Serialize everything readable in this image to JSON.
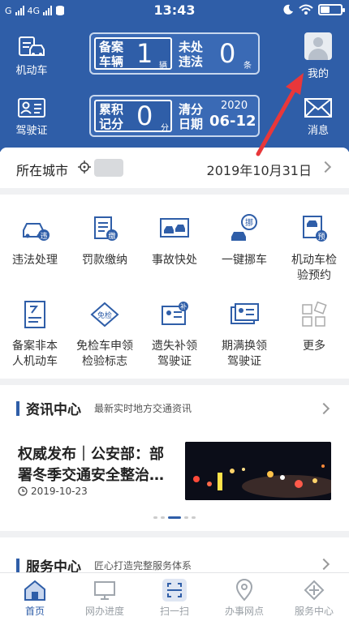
{
  "status_bar": {
    "carrier_left": "G",
    "network": "4G",
    "time": "13:43"
  },
  "header": {
    "left_top": {
      "label": "机动车",
      "icon": "vehicle-icon"
    },
    "left_bottom": {
      "label": "驾驶证",
      "icon": "license-icon"
    },
    "right_top": {
      "label": "我的",
      "icon": "avatar-icon"
    },
    "right_bottom": {
      "label": "消息",
      "icon": "mail-icon"
    },
    "panel_vehicle": {
      "label1": "备案",
      "label2": "车辆",
      "count": "1",
      "unit": "辆",
      "label3": "未处",
      "label4": "违法",
      "violations": "0",
      "unit2": "条"
    },
    "panel_points": {
      "label1": "累积",
      "label2": "记分",
      "points": "0",
      "unit": "分",
      "label3": "清分",
      "label4": "日期",
      "year": "2020",
      "date": "06-12"
    }
  },
  "city_row": {
    "label": "所在城市",
    "date": "2019年10月31日"
  },
  "services_grid": [
    {
      "label": "违法处理",
      "icon": "violation-icon"
    },
    {
      "label": "罚款缴纳",
      "icon": "fine-payment-icon"
    },
    {
      "label": "事故快处",
      "icon": "accident-icon"
    },
    {
      "label": "一键挪车",
      "icon": "move-car-icon"
    },
    {
      "label": "机动车检验预约",
      "icon": "inspection-booking-icon"
    },
    {
      "label": "备案非本人机动车",
      "icon": "register-vehicle-icon"
    },
    {
      "label": "免检车申领检验标志",
      "icon": "exempt-inspection-icon"
    },
    {
      "label": "遗失补领驾驶证",
      "icon": "lost-license-icon"
    },
    {
      "label": "期满换领驾驶证",
      "icon": "renew-license-icon"
    },
    {
      "label": "更多",
      "icon": "more-icon"
    }
  ],
  "news": {
    "title": "资讯中心",
    "subtitle": "最新实时地方交通资讯",
    "headline": "权威发布｜公安部：部署冬季交通安全整治…",
    "date": "2019-10-23"
  },
  "service_center": {
    "title": "服务中心",
    "subtitle": "匠心打造完整服务体系"
  },
  "tabbar": [
    {
      "label": "首页",
      "icon": "home-icon",
      "active": true
    },
    {
      "label": "网办进度",
      "icon": "monitor-icon"
    },
    {
      "label": "扫一扫",
      "icon": "scan-icon"
    },
    {
      "label": "办事网点",
      "icon": "location-icon"
    },
    {
      "label": "服务中心",
      "icon": "service-icon"
    }
  ],
  "colors": {
    "brand": "#2f5ea8",
    "annotation_arrow": "#e8373a"
  }
}
